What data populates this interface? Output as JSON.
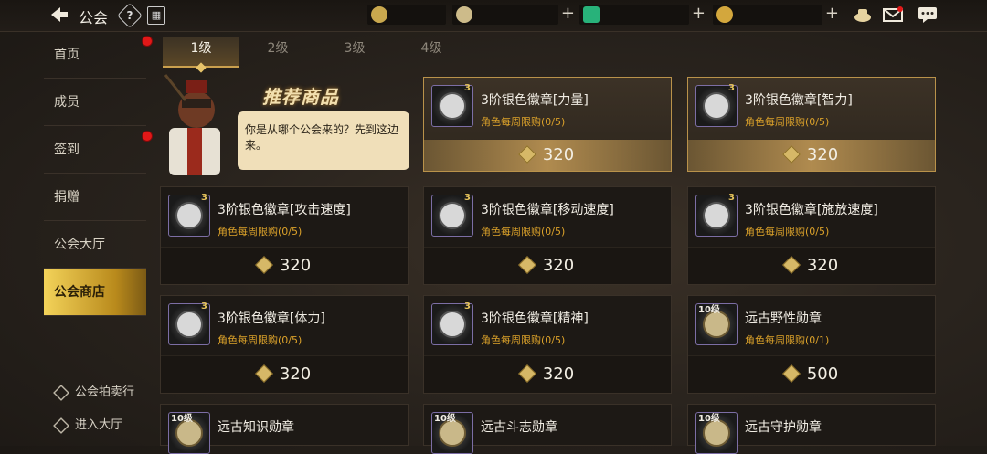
{
  "header": {
    "title": "公会",
    "help_label": "?",
    "currencies": [
      {
        "icon": "gold-coin-icon",
        "value": ""
      },
      {
        "icon": "silver-coin-icon",
        "value": ""
      },
      {
        "icon": "green-gem-icon",
        "value": ""
      },
      {
        "icon": "bonus-coin-icon",
        "value": ""
      }
    ],
    "plus_label": "+"
  },
  "sidebar": {
    "items": [
      {
        "label": "首页",
        "badge": true
      },
      {
        "label": "成员",
        "badge": false
      },
      {
        "label": "签到",
        "badge": true
      },
      {
        "label": "捐赠",
        "badge": false
      },
      {
        "label": "公会大厅",
        "badge": false
      },
      {
        "label": "公会商店",
        "badge": false,
        "active": true
      }
    ],
    "bottom": [
      {
        "label": "公会拍卖行"
      },
      {
        "label": "进入大厅"
      }
    ]
  },
  "tabs": [
    "1级",
    "2级",
    "3级",
    "4级"
  ],
  "featured": {
    "title": "推荐商品",
    "npc_speech": "你是从哪个公会来的？先到这边来。"
  },
  "shop": {
    "items": [
      {
        "name": "3阶银色徽章[力量]",
        "limit": "角色每周限购(0/5)",
        "price": "320",
        "tier": "3",
        "icon": "strength-badge-icon"
      },
      {
        "name": "3阶银色徽章[智力]",
        "limit": "角色每周限购(0/5)",
        "price": "320",
        "tier": "3",
        "icon": "intelligence-badge-icon"
      },
      {
        "name": "3阶银色徽章[攻击速度]",
        "limit": "角色每周限购(0/5)",
        "price": "320",
        "tier": "3",
        "icon": "attack-speed-badge-icon"
      },
      {
        "name": "3阶银色徽章[移动速度]",
        "limit": "角色每周限购(0/5)",
        "price": "320",
        "tier": "3",
        "icon": "move-speed-badge-icon"
      },
      {
        "name": "3阶银色徽章[施放速度]",
        "limit": "角色每周限购(0/5)",
        "price": "320",
        "tier": "3",
        "icon": "cast-speed-badge-icon"
      },
      {
        "name": "3阶银色徽章[体力]",
        "limit": "角色每周限购(0/5)",
        "price": "320",
        "tier": "3",
        "icon": "stamina-badge-icon"
      },
      {
        "name": "3阶银色徽章[精神]",
        "limit": "角色每周限购(0/5)",
        "price": "320",
        "tier": "3",
        "icon": "spirit-badge-icon"
      },
      {
        "name": "远古野性勋章",
        "limit": "角色每周限购(0/1)",
        "price": "500",
        "tier": "10级",
        "icon": "ancient-wild-medal-icon"
      },
      {
        "name": "远古知识勋章",
        "limit": "",
        "price": "",
        "tier": "10级",
        "icon": "ancient-knowledge-medal-icon"
      },
      {
        "name": "远古斗志勋章",
        "limit": "",
        "price": "",
        "tier": "10级",
        "icon": "ancient-fighting-medal-icon"
      },
      {
        "name": "远古守护勋章",
        "limit": "",
        "price": "",
        "tier": "10级",
        "icon": "ancient-guard-medal-icon"
      }
    ]
  }
}
